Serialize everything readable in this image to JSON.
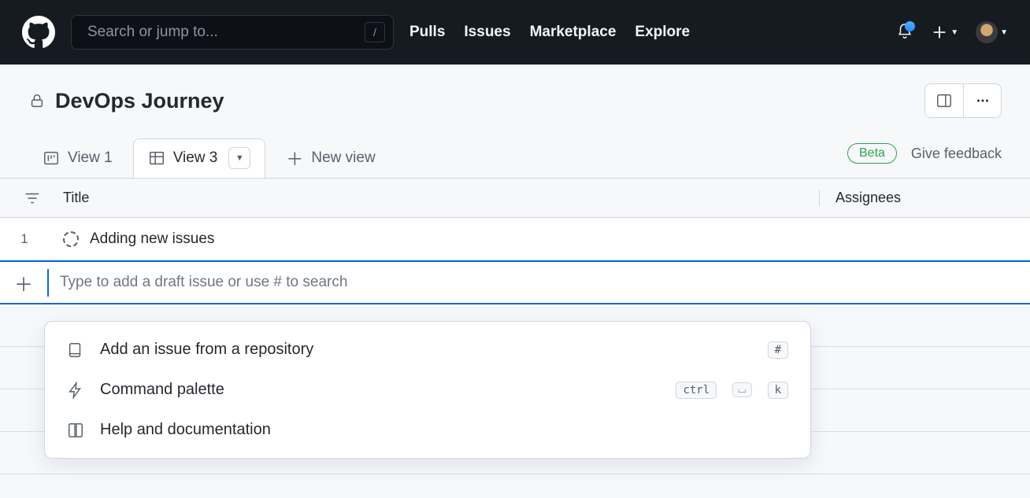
{
  "nav": {
    "search_placeholder": "Search or jump to...",
    "search_key": "/",
    "links": [
      "Pulls",
      "Issues",
      "Marketplace",
      "Explore"
    ]
  },
  "project": {
    "title": "DevOps Journey"
  },
  "tabs": {
    "items": [
      {
        "label": "View 1",
        "active": false
      },
      {
        "label": "View 3",
        "active": true
      }
    ],
    "new_view_label": "New view",
    "beta_label": "Beta",
    "feedback_label": "Give feedback"
  },
  "columns": {
    "title": "Title",
    "assignees": "Assignees"
  },
  "rows": [
    {
      "num": "1",
      "title": "Adding new issues"
    }
  ],
  "add_row": {
    "placeholder": "Type to add a draft issue or use # to search"
  },
  "popover": {
    "items": [
      {
        "label": "Add an issue from a repository",
        "key": "#",
        "icon": "repo"
      },
      {
        "label": "Command palette",
        "key_combo": [
          "ctrl",
          "k"
        ],
        "icon": "zap"
      },
      {
        "label": "Help and documentation",
        "icon": "book"
      }
    ]
  }
}
